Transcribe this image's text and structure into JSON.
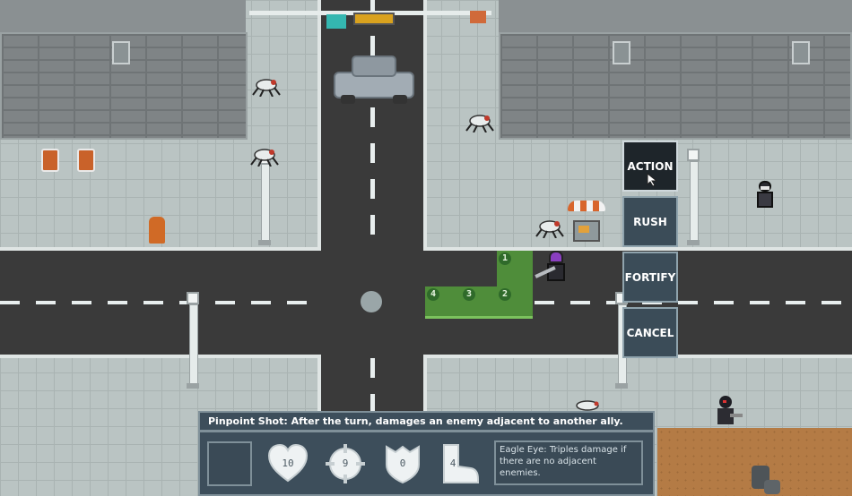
{
  "action_menu": {
    "items": [
      {
        "label": "ACTION",
        "active": true
      },
      {
        "label": "RUSH",
        "active": false
      },
      {
        "label": "FORTIFY",
        "active": false
      },
      {
        "label": "CANCEL",
        "active": false
      }
    ]
  },
  "movement_tiles": [
    "1",
    "2",
    "3",
    "4"
  ],
  "ability_panel": {
    "ability_text": "Pinpoint Shot: After the turn, damages an enemy adjacent to another ally.",
    "stats": {
      "health": "10",
      "accuracy": "9",
      "armor": "0",
      "movement": "4"
    },
    "passive_text": "Eagle Eye: Triples damage if there are no adjacent enemies."
  },
  "colors": {
    "road": "#3a3a3a",
    "sidewalk": "#bac4c3",
    "move_tile": "#4f8d3a",
    "panel": "#3d4e5b",
    "hero_accent": "#8a3fc0",
    "trash_can": "#c9622a"
  }
}
